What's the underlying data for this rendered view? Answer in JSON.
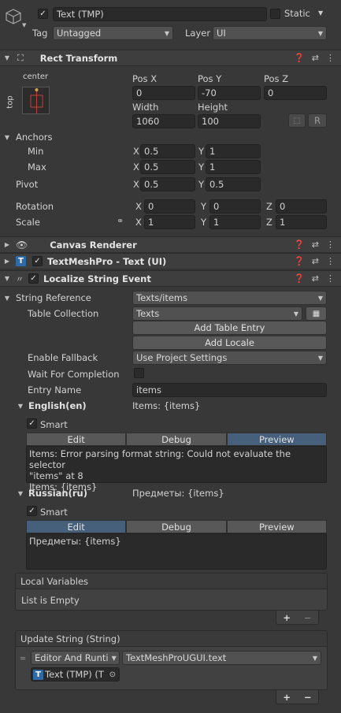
{
  "header": {
    "enabled": true,
    "object_name": "Text (TMP)",
    "static_label": "Static",
    "tag_label": "Tag",
    "tag_value": "Untagged",
    "layer_label": "Layer",
    "layer_value": "UI"
  },
  "rect_transform": {
    "title": "Rect Transform",
    "anchor_top_label": "center",
    "anchor_side_label": "top",
    "pos_x_label": "Pos X",
    "pos_y_label": "Pos Y",
    "pos_z_label": "Pos Z",
    "pos_x": "0",
    "pos_y": "-70",
    "pos_z": "0",
    "width_label": "Width",
    "height_label": "Height",
    "width": "1060",
    "height": "100",
    "r_button": "R",
    "anchors_label": "Anchors",
    "min_label": "Min",
    "max_label": "Max",
    "min_x": "0.5",
    "min_y": "1",
    "max_x": "0.5",
    "max_y": "1",
    "pivot_label": "Pivot",
    "pivot_x": "0.5",
    "pivot_y": "0.5",
    "rotation_label": "Rotation",
    "rot_x": "0",
    "rot_y": "0",
    "rot_z": "0",
    "scale_label": "Scale",
    "scale_x": "1",
    "scale_y": "1",
    "scale_z": "1",
    "axis_x": "X",
    "axis_y": "Y",
    "axis_z": "Z"
  },
  "canvas_renderer": {
    "title": "Canvas Renderer"
  },
  "textmeshpro": {
    "title": "TextMeshPro - Text (UI)",
    "enabled": true
  },
  "localize": {
    "title": "Localize String Event",
    "enabled": true,
    "string_reference_label": "String Reference",
    "string_reference_value": "Texts/items",
    "table_collection_label": "Table Collection",
    "table_collection_value": "Texts",
    "add_table_entry": "Add Table Entry",
    "add_locale": "Add Locale",
    "enable_fallback_label": "Enable Fallback",
    "enable_fallback_value": "Use Project Settings",
    "wait_for_completion_label": "Wait For Completion",
    "entry_name_label": "Entry Name",
    "entry_name_value": "items",
    "english": {
      "label": "English(en)",
      "preview": "Items: {items}",
      "smart_label": "Smart",
      "tabs": [
        "Edit",
        "Debug",
        "Preview"
      ],
      "active_tab": 2,
      "output_line1": "Items: Error parsing format string: Could not evaluate the selector",
      "output_line2": "\"items\" at 8",
      "output_line3": "Items: {items}"
    },
    "russian": {
      "label": "Russian(ru)",
      "preview": "Предметы: {items}",
      "smart_label": "Smart",
      "tabs": [
        "Edit",
        "Debug",
        "Preview"
      ],
      "active_tab": 0,
      "output_line1": "Предметы: {items}"
    },
    "local_variables_label": "Local Variables",
    "list_empty": "List is Empty",
    "plus": "+",
    "minus": "−",
    "update_string_label": "Update String (String)",
    "runtime_mode": "Editor And Runti",
    "function_value": "TextMeshProUGUI.text",
    "target_object": "Text (TMP) (T"
  },
  "colors": {
    "background": "#383838",
    "active_tab": "#46607c",
    "tmp_icon": "#2e6aa6"
  }
}
